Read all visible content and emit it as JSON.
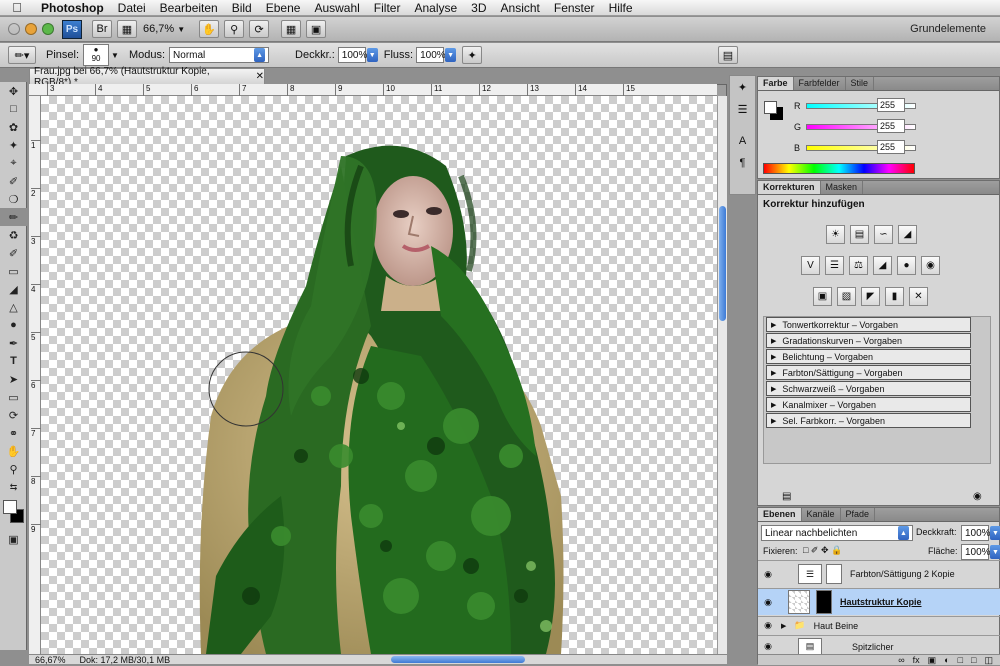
{
  "menubar": {
    "app": "Photoshop",
    "items": [
      "Datei",
      "Bearbeiten",
      "Bild",
      "Ebene",
      "Auswahl",
      "Filter",
      "Analyse",
      "3D",
      "Ansicht",
      "Fenster",
      "Hilfe"
    ]
  },
  "appbar": {
    "logo": "Ps",
    "zoom": "66,7%",
    "workspace": "Grundelemente"
  },
  "options": {
    "brush_label": "Pinsel:",
    "brush_size": "90",
    "mode_label": "Modus:",
    "mode_value": "Normal",
    "opacity_label": "Deckkr.:",
    "opacity_value": "100%",
    "flow_label": "Fluss:",
    "flow_value": "100%"
  },
  "document": {
    "tab_title": "Frau.jpg bei 66,7% (Hautstruktur Kopie, RGB/8*) *",
    "ruler_top": [
      "3",
      "4",
      "5",
      "6",
      "7",
      "8",
      "9",
      "10",
      "11",
      "12",
      "13",
      "14",
      "15"
    ],
    "ruler_left": [
      "1",
      "2",
      "3",
      "4",
      "5",
      "6",
      "7",
      "8",
      "9"
    ],
    "status_zoom": "66,67%",
    "status_doc": "Dok: 17,2 MB/30,1 MB"
  },
  "color_panel": {
    "tabs": [
      "Farbe",
      "Farbfelder",
      "Stile"
    ],
    "r_label": "R",
    "g_label": "G",
    "b_label": "B",
    "r": "255",
    "g": "255",
    "b": "255"
  },
  "adjust_panel": {
    "tabs": [
      "Korrekturen",
      "Masken"
    ],
    "heading": "Korrektur hinzufügen",
    "presets": [
      "Tonwertkorrektur – Vorgaben",
      "Gradationskurven – Vorgaben",
      "Belichtung – Vorgaben",
      "Farbton/Sättigung – Vorgaben",
      "Schwarzweiß – Vorgaben",
      "Kanalmixer – Vorgaben",
      "Sel. Farbkorr. – Vorgaben"
    ]
  },
  "layers_panel": {
    "tabs": [
      "Ebenen",
      "Kanäle",
      "Pfade"
    ],
    "blend_mode": "Linear nachbelichten",
    "opacity_label": "Deckkraft:",
    "opacity": "100%",
    "lock_label": "Fixieren:",
    "fill_label": "Fläche:",
    "fill": "100%",
    "layers": [
      "Farbton/Sättigung 2 Kopie",
      "Hautstruktur Kopie",
      "Haut Beine",
      "Spitzlicher"
    ]
  }
}
